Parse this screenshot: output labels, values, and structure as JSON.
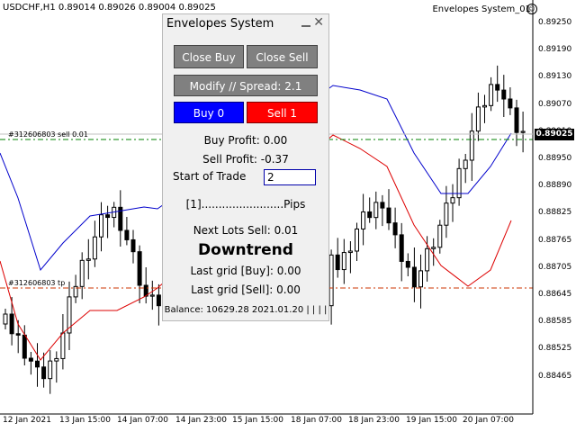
{
  "chart": {
    "symbol_info": "USDCHF,H1  0.89014 0.89026 0.89004 0.89025",
    "ea_label": "Envelopes System_01",
    "order_sell_label": "#312606803 sell 0.01",
    "order_tp_label": "#312606803 tp",
    "price_axis": [
      "0.89250",
      "0.89190",
      "0.89130",
      "0.89070",
      "0.89010",
      "0.88950",
      "0.88890",
      "0.88825",
      "0.88765",
      "0.88705",
      "0.88645",
      "0.88585",
      "0.88525",
      "0.88465"
    ],
    "current_price": "0.89025",
    "time_axis": [
      "12 Jan 2021",
      "13 Jan 15:00",
      "14 Jan 07:00",
      "14 Jan 23:00",
      "15 Jan 15:00",
      "18 Jan 07:00",
      "18 Jan 23:00",
      "19 Jan 15:00",
      "20 Jan 07:00"
    ],
    "colors": {
      "upper_band": "#0000cc",
      "lower_band": "#dd0000",
      "sell_line": "#008000",
      "tp_line": "#cc3300",
      "candle": "#000000"
    }
  },
  "panel": {
    "title": "Envelopes System",
    "close_buy": "Close Buy",
    "close_sell": "Close Sell",
    "modify": "Modify // Spread: 2.1",
    "buy": "Buy 0",
    "sell": "Sell 1",
    "buy_profit": "Buy Profit: 0.00",
    "sell_profit": "Sell Profit: -0.37",
    "start_of_trade_label": "Start of Trade",
    "start_of_trade_value": "2",
    "pips": "[1]........................Pips",
    "next_lots": "Next Lots Sell: 0.01",
    "trend": "Downtrend",
    "last_grid_buy": "Last grid [Buy]: 0.00",
    "last_grid_sell": "Last grid [Sell]: 0.00",
    "balance": "Balance: 10629.28 2021.01.20 | | | |"
  }
}
